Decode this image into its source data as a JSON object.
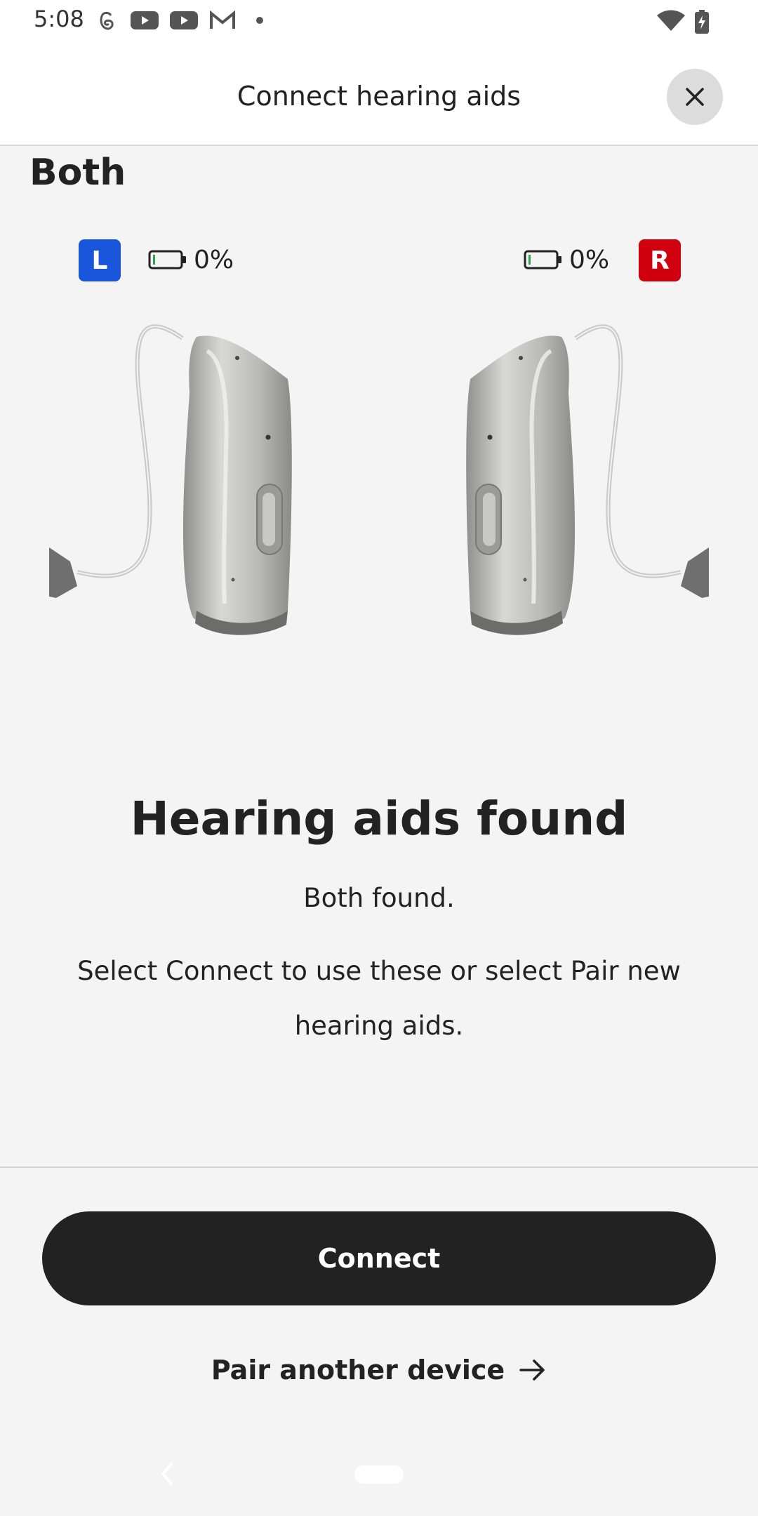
{
  "status_bar": {
    "time": "5:08",
    "icons": [
      "threads-icon",
      "youtube-icon",
      "youtube-icon",
      "gmail-icon",
      "dot-icon",
      "wifi-icon",
      "battery-charging-icon"
    ]
  },
  "header": {
    "title": "Connect hearing aids",
    "close_icon": "close-icon"
  },
  "side_label": "Both",
  "left_aid": {
    "badge": "L",
    "battery": "0%",
    "badge_color": "#1a56db"
  },
  "right_aid": {
    "badge": "R",
    "battery": "0%",
    "badge_color": "#d1000f"
  },
  "result": {
    "title": "Hearing aids found",
    "subtitle": "Both found.",
    "description": "Select Connect to use these or select Pair new hearing aids."
  },
  "actions": {
    "connect_label": "Connect",
    "pair_label": "Pair another device",
    "pair_icon": "arrow-right-icon"
  }
}
